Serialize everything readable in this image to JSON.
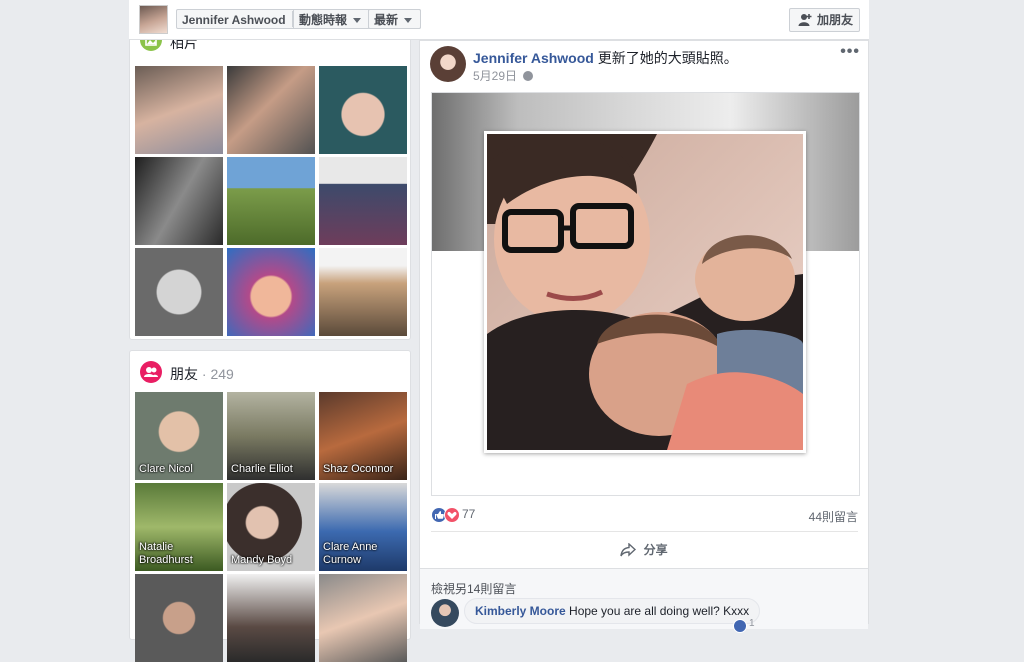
{
  "topbar": {
    "profile_name": "Jennifer Ashwood",
    "section_tab": "動態時報",
    "sort_tab": "最新",
    "add_friend_label": "加朋友"
  },
  "photos": {
    "title": "相片",
    "tiles": [
      "photo-1",
      "photo-2",
      "photo-3",
      "photo-4",
      "photo-5",
      "photo-6",
      "photo-7",
      "photo-8",
      "photo-9"
    ]
  },
  "friends": {
    "title": "朋友",
    "count": "· 249",
    "items": [
      {
        "name": "Clare Nicol"
      },
      {
        "name": "Charlie Elliot"
      },
      {
        "name": "Shaz Oconnor"
      },
      {
        "name": "Natalie Broadhurst"
      },
      {
        "name": "Mandy Boyd"
      },
      {
        "name": "Clare Anne Curnow"
      },
      {
        "name": ""
      },
      {
        "name": ""
      },
      {
        "name": ""
      }
    ]
  },
  "post": {
    "author": "Jennifer Ashwood",
    "action": "更新了她的大頭貼照。",
    "date": "5月29日",
    "more": "•••",
    "reactions_count": "77",
    "comments_count": "44則留言",
    "share_label": "分享",
    "view_more_comments": "檢視另14則留言",
    "comment": {
      "author": "Kimberly Moore",
      "text": "Hope you are all doing well? Kxxx",
      "likes": "1"
    }
  },
  "colors": {
    "link": "#365899",
    "background": "#e9ebee",
    "photos_icon": "#8bc34a",
    "friends_icon": "#e91e63",
    "like": "#4267b2",
    "love": "#f25268"
  }
}
